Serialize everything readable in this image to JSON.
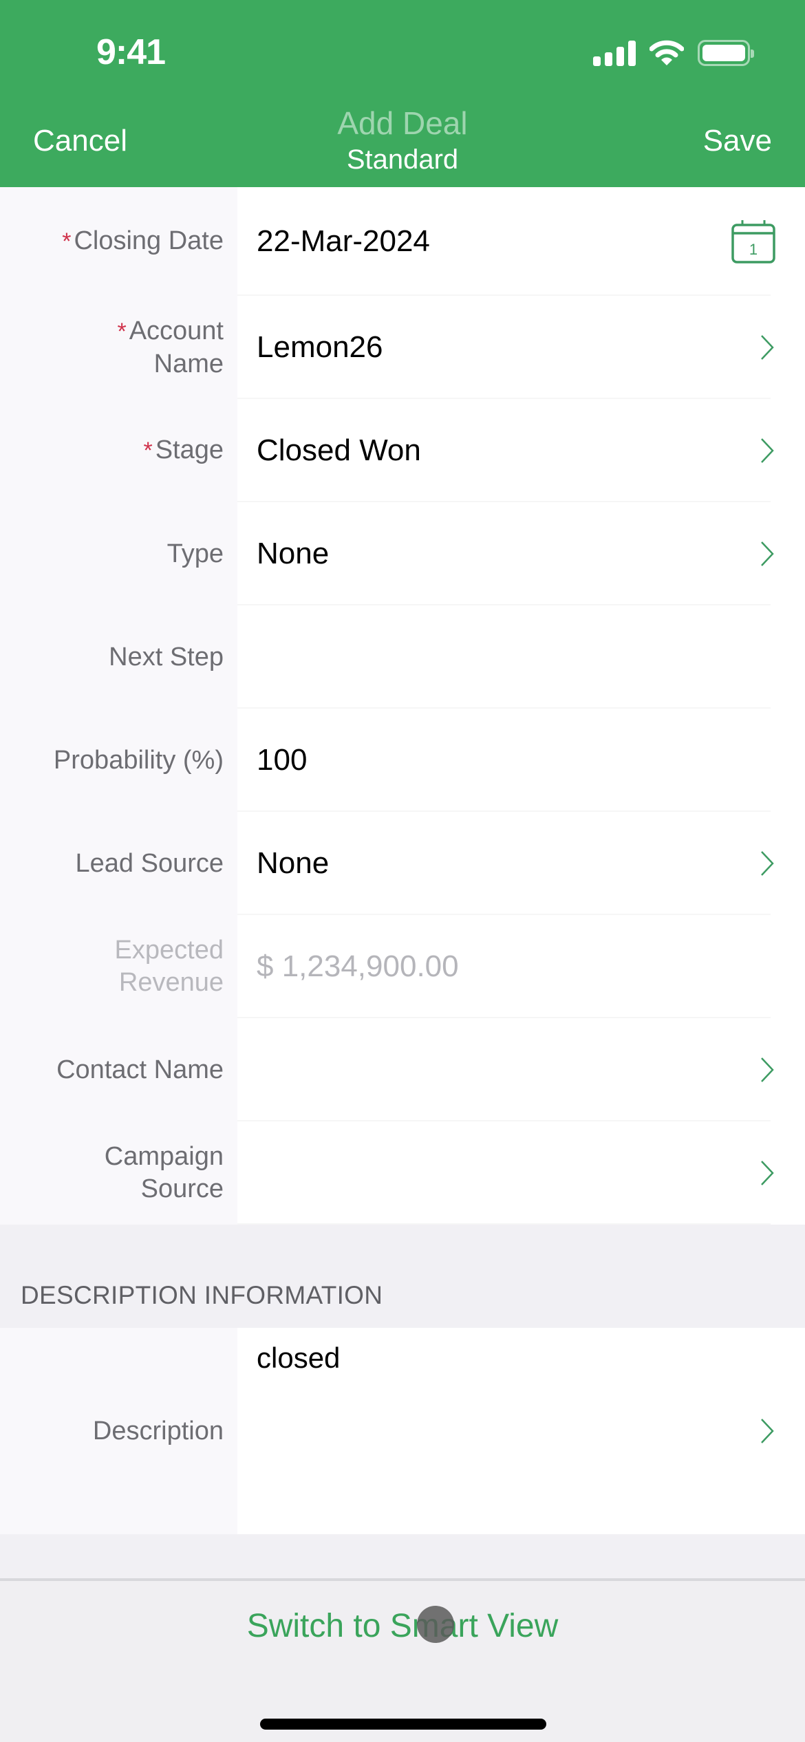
{
  "status_bar": {
    "time": "9:41",
    "icons": [
      "cellular-signal-icon",
      "wifi-icon",
      "battery-icon"
    ]
  },
  "nav": {
    "cancel_label": "Cancel",
    "title": "Add Deal",
    "subtitle": "Standard",
    "save_label": "Save"
  },
  "colors": {
    "brand_green": "#3daa5e",
    "required_red": "#d0324b",
    "label_gray": "#6d6d72"
  },
  "fields": [
    {
      "label": "Closing Date",
      "required": true,
      "value": "22-Mar-2024",
      "accessory": "calendar-icon",
      "calendar_day": "1"
    },
    {
      "label": "Account Name",
      "label_lines": [
        "Account",
        "Name"
      ],
      "required": true,
      "value": "Lemon26",
      "accessory": "chevron-right-icon"
    },
    {
      "label": "Stage",
      "required": true,
      "value": "Closed Won",
      "accessory": "chevron-right-icon"
    },
    {
      "label": "Type",
      "required": false,
      "value": "None",
      "accessory": "chevron-right-icon"
    },
    {
      "label": "Next Step",
      "required": false,
      "value": "",
      "accessory": null
    },
    {
      "label": "Probability (%)",
      "required": false,
      "value": "100",
      "accessory": null
    },
    {
      "label": "Lead Source",
      "required": false,
      "value": "None",
      "accessory": "chevron-right-icon"
    },
    {
      "label": "Expected Revenue",
      "label_lines": [
        "Expected",
        "Revenue"
      ],
      "required": false,
      "value": "$ 1,234,900.00",
      "disabled": true,
      "accessory": null
    },
    {
      "label": "Contact Name",
      "required": false,
      "value": "",
      "accessory": "chevron-right-icon"
    },
    {
      "label": "Campaign Source",
      "label_lines": [
        "Campaign",
        "Source"
      ],
      "required": false,
      "value": "",
      "accessory": "chevron-right-icon"
    }
  ],
  "description_section": {
    "header": "DESCRIPTION INFORMATION",
    "label": "Description",
    "value": "closed"
  },
  "footer": {
    "switch_view_label": "Switch to Smart View"
  }
}
